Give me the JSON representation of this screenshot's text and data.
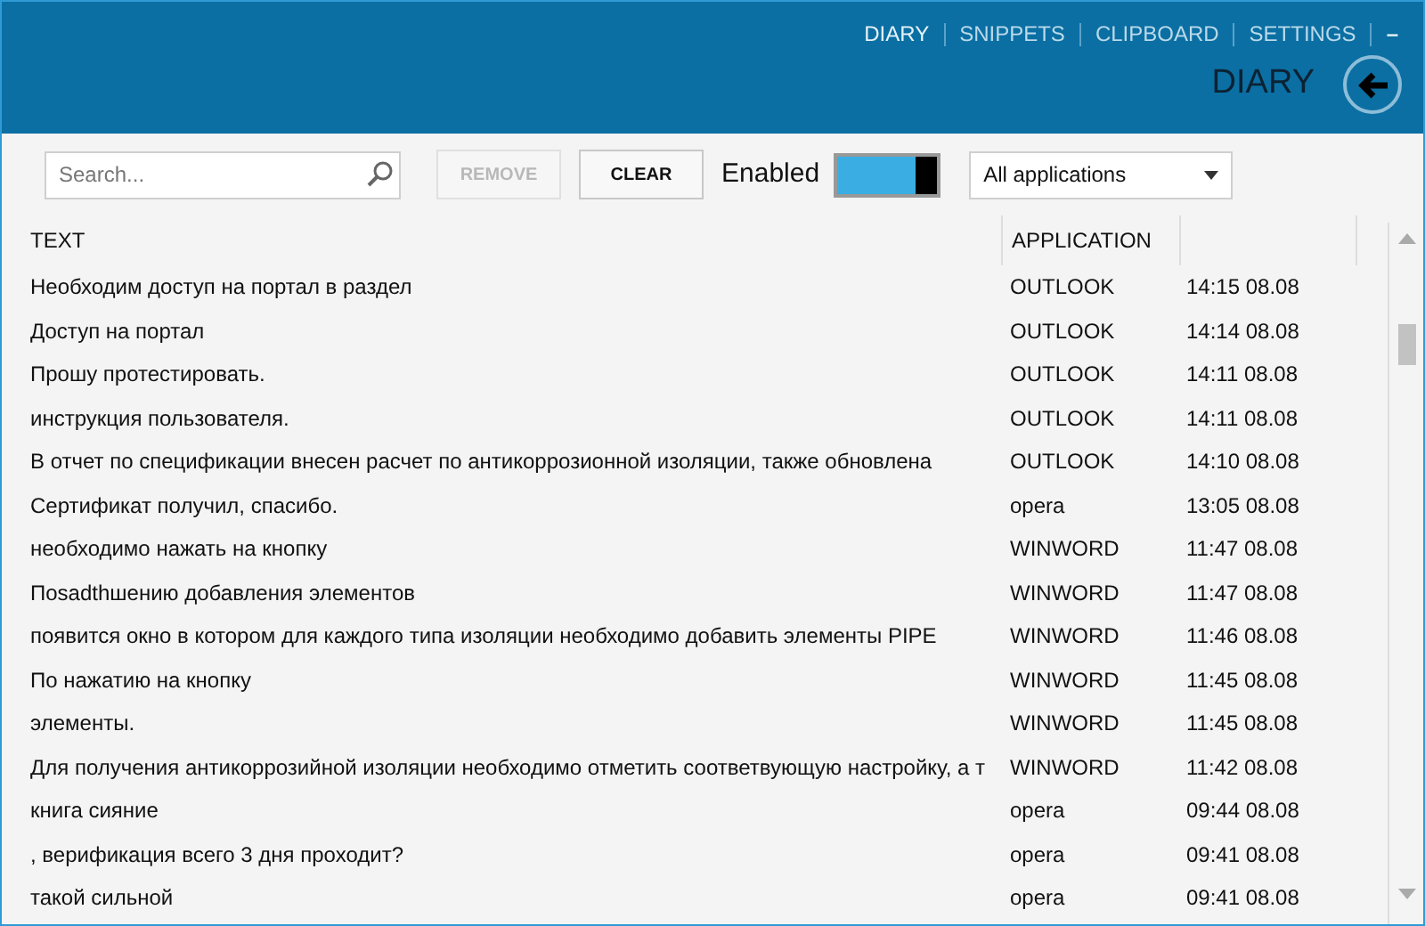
{
  "nav": [
    {
      "label": "DIARY",
      "selected": true
    },
    {
      "label": "SNIPPETS",
      "selected": false
    },
    {
      "label": "CLIPBOARD",
      "selected": false
    },
    {
      "label": "SETTINGS",
      "selected": false
    }
  ],
  "minimize": "–",
  "page_title": "DIARY",
  "toolbar": {
    "search": {
      "placeholder": "Search..."
    },
    "remove": {
      "label": "REMOVE",
      "disabled": true
    },
    "clear": {
      "label": "CLEAR",
      "disabled": false
    },
    "enabled_label": "Enabled",
    "enabled_on": true,
    "filter": {
      "value": "All applications"
    }
  },
  "table": {
    "columns": [
      "TEXT",
      "APPLICATION"
    ],
    "rows": [
      {
        "text": "Необходим доступ на портал в раздел",
        "application": "OUTLOOK",
        "time": "14:15 08.08"
      },
      {
        "text": "Доступ на портал",
        "application": "OUTLOOK",
        "time": "14:14 08.08"
      },
      {
        "text": "Прошу протестировать.",
        "application": "OUTLOOK",
        "time": "14:11 08.08"
      },
      {
        "text": "инструкция пользователя.",
        "application": "OUTLOOK",
        "time": "14:11 08.08"
      },
      {
        "text": "В отчет по спецификации внесен расчет по антикоррозионной изоляции, также обновлена",
        "application": "OUTLOOK",
        "time": "14:10 08.08"
      },
      {
        "text": "Сертификат получил, спасибо.",
        "application": "opera",
        "time": "13:05 08.08"
      },
      {
        "text": "необходимо нажать на кнопку",
        "application": "WINWORD",
        "time": "11:47 08.08"
      },
      {
        "text": "Поsadthшению добавления элементов",
        "application": "WINWORD",
        "time": "11:47 08.08"
      },
      {
        "text": "появится окно в котором для каждого типа изоляции необходимо добавить элементы PIPE",
        "application": "WINWORD",
        "time": "11:46 08.08"
      },
      {
        "text": "По нажатию на кнопку",
        "application": "WINWORD",
        "time": "11:45 08.08"
      },
      {
        "text": "элементы.",
        "application": "WINWORD",
        "time": "11:45 08.08"
      },
      {
        "text": "Для получения антикоррозийной изоляции необходимо отметить соответвующую настройку, а т",
        "application": "WINWORD",
        "time": "11:42 08.08"
      },
      {
        "text": "книга сияние",
        "application": "opera",
        "time": "09:44 08.08"
      },
      {
        "text": ", верификация всего 3 дня проходит?",
        "application": "opera",
        "time": "09:41 08.08"
      },
      {
        "text": "такой сильной",
        "application": "opera",
        "time": "09:41 08.08"
      }
    ]
  }
}
